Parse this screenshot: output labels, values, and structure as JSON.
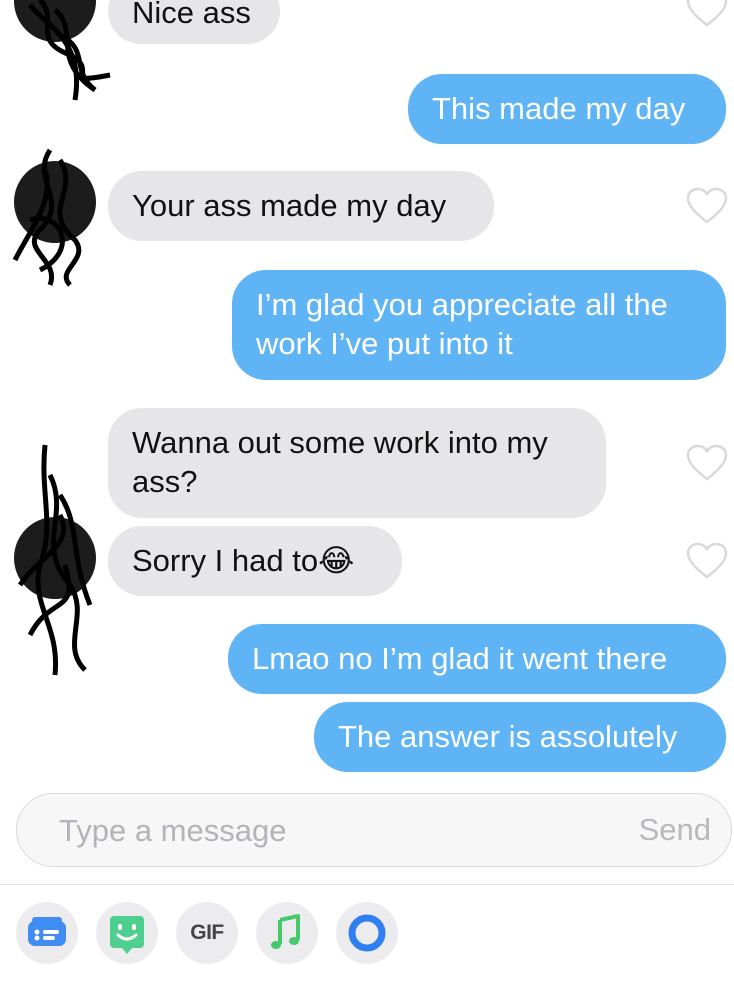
{
  "messages": [
    {
      "direction": "incoming",
      "text": "Nice ass"
    },
    {
      "direction": "outgoing",
      "text": "This made my day"
    },
    {
      "direction": "incoming",
      "text": "Your ass made my day"
    },
    {
      "direction": "outgoing",
      "text": "I’m glad you appreciate all the work I’ve put into it"
    },
    {
      "direction": "incoming",
      "text": "Wanna out some work into my ass?"
    },
    {
      "direction": "incoming",
      "text": "Sorry I had to",
      "emoji": "😂"
    },
    {
      "direction": "outgoing",
      "text": "Lmao no I’m glad it went there"
    },
    {
      "direction": "outgoing",
      "text": "The answer is assolutely"
    }
  ],
  "composer": {
    "placeholder": "Type a message",
    "value": "",
    "send_label": "Send"
  },
  "toolbar": {
    "items": [
      {
        "icon": "sticker-card-icon"
      },
      {
        "icon": "bitmoji-face-icon"
      },
      {
        "icon": "gif-icon",
        "label": "GIF"
      },
      {
        "icon": "music-note-icon"
      },
      {
        "icon": "loop-ring-icon"
      }
    ]
  },
  "colors": {
    "outgoing_bubble": "#5fb4f6",
    "incoming_bubble": "#e6e6e8",
    "music_icon": "#45c96a",
    "bitmoji_icon": "#4fcf8f",
    "loop_icon": "#2f7ef2",
    "card_icon": "#3f8cf3"
  }
}
